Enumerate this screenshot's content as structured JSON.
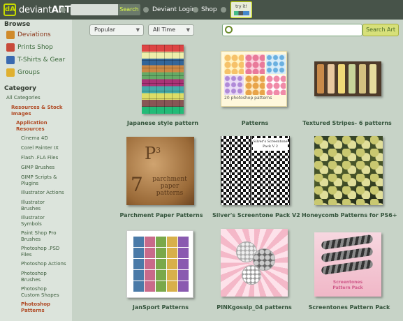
{
  "topbar": {
    "logo_mark": "dA",
    "logo_word_a": "deviant",
    "logo_word_b": "ART",
    "search_button": "Search",
    "links": [
      "Deviant Login",
      "Shop"
    ],
    "try_it": "try it!"
  },
  "sidebar": {
    "browse_heading": "Browse",
    "nav": [
      {
        "label": "Deviations",
        "icon": "deviations-icon",
        "color": "#d08a2a"
      },
      {
        "label": "Prints Shop",
        "icon": "prints-icon",
        "color": "#c84a3a"
      },
      {
        "label": "T-Shirts & Gear",
        "icon": "tshirt-icon",
        "color": "#3a6ab0"
      },
      {
        "label": "Groups",
        "icon": "groups-icon",
        "color": "#e0b030"
      }
    ],
    "category_heading": "Category",
    "categories": [
      "All Categories",
      "Resources & Stock Images",
      "Application Resources",
      "Cinema 4D",
      "Corel Painter IX",
      "Flash .FLA Files",
      "GIMP Brushes",
      "GIMP Scripts & Plugins",
      "Illustrator Actions",
      "Illustrator Brushes",
      "Illustrator Symbols",
      "Paint Shop Pro Brushes",
      "Photoshop .PSD Files",
      "Photoshop Actions",
      "Photoshop Brushes",
      "Photoshop Custom Shapes",
      "Photoshop Patterns"
    ]
  },
  "filters": {
    "sort": "Popular",
    "time": "All Time"
  },
  "search": {
    "value": "",
    "button": "Search Art"
  },
  "items": [
    {
      "caption": "Japanese style pattern"
    },
    {
      "caption": "Patterns",
      "thumb_text": "20 photoshop patterns"
    },
    {
      "caption": "Textured Stripes- 6 patterns"
    },
    {
      "caption": "Parchment Paper Patterns",
      "thumb_big": "P",
      "thumb_sup": "3",
      "thumb_num": "7",
      "thumb_text": "parchment paper patterns"
    },
    {
      "caption": "Silver's Screentone Pack V2",
      "thumb_text": "Silver's Screentone Pack V 2"
    },
    {
      "caption": "Honeycomb Patterns for PS6+"
    },
    {
      "caption": "JanSport Patterns"
    },
    {
      "caption": "PINKgossip_04 patterns"
    },
    {
      "caption": "Screentones Pattern Pack",
      "thumb_text": "Screentones Pattern Pack"
    }
  ],
  "colors": {
    "topbar": "#475349",
    "accent": "#c6d900",
    "background": "#c7d3c7",
    "sidebar": "#dce4dc",
    "caption": "#34543c",
    "highlight": "#b04a24"
  }
}
